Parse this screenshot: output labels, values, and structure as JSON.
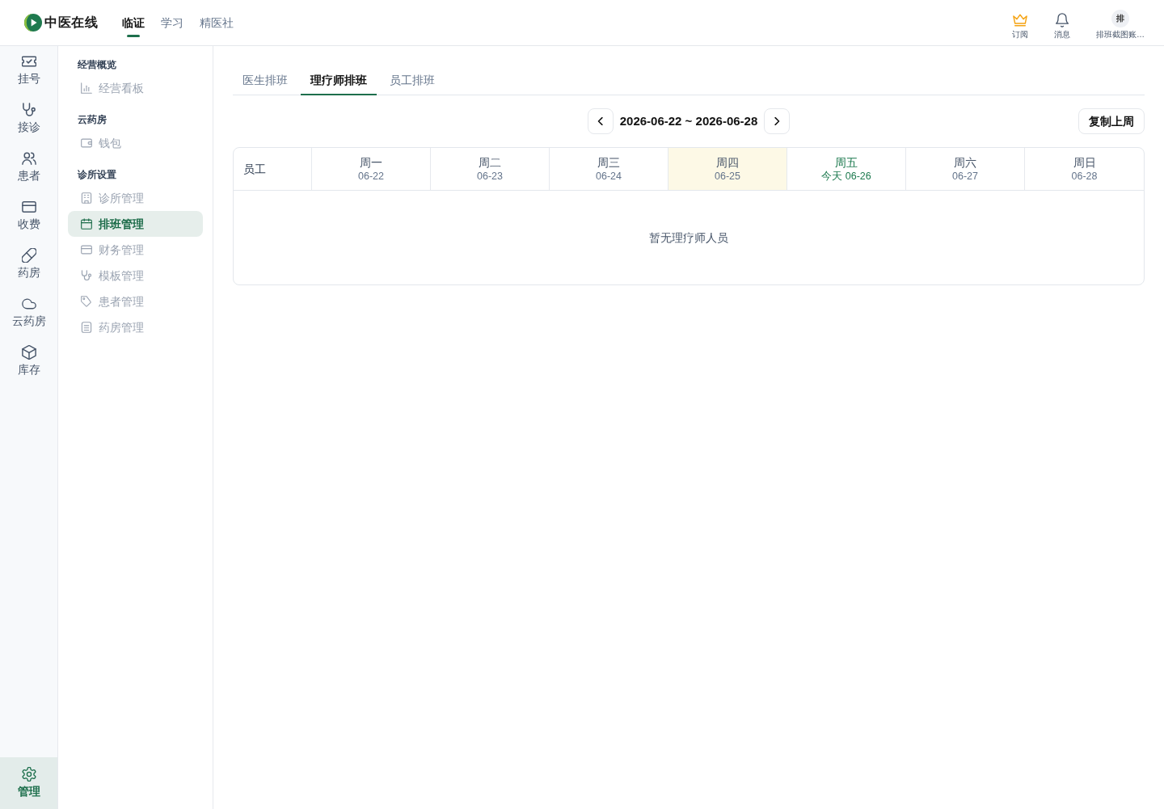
{
  "topbar": {
    "logo": "中医在线",
    "nav": [
      {
        "label": "临证",
        "selected": true
      },
      {
        "label": "学习",
        "selected": false
      },
      {
        "label": "精医社",
        "selected": false
      }
    ],
    "actions": [
      {
        "kind": "subscribe",
        "label": "订阅"
      },
      {
        "kind": "messages",
        "label": "消息"
      },
      {
        "kind": "account",
        "avatar": "排",
        "label": "排班截图账…"
      }
    ]
  },
  "rail": {
    "items": [
      {
        "label": "挂号",
        "selected": false
      },
      {
        "label": "接诊",
        "selected": false
      },
      {
        "label": "患者",
        "selected": false
      },
      {
        "label": "收费",
        "selected": false
      },
      {
        "label": "药房",
        "selected": false
      },
      {
        "label": "云药房",
        "selected": false
      },
      {
        "label": "库存",
        "selected": false
      }
    ],
    "footer": {
      "label": "管理",
      "selected": true
    }
  },
  "menu": {
    "groups": [
      {
        "title": "经营概览",
        "items": [
          {
            "label": "经营看板",
            "selected": false
          }
        ]
      },
      {
        "title": "云药房",
        "items": [
          {
            "label": "钱包",
            "selected": false
          }
        ]
      },
      {
        "title": "诊所设置",
        "items": [
          {
            "label": "诊所管理",
            "selected": false
          },
          {
            "label": "排班管理",
            "selected": true
          },
          {
            "label": "财务管理",
            "selected": false
          },
          {
            "label": "模板管理",
            "selected": false
          },
          {
            "label": "患者管理",
            "selected": false
          },
          {
            "label": "药房管理",
            "selected": false
          }
        ]
      }
    ]
  },
  "tabs": [
    {
      "label": "医生排班",
      "selected": false
    },
    {
      "label": "理疗师排班",
      "selected": true
    },
    {
      "label": "员工排班",
      "selected": false
    }
  ],
  "week_range": "2026-06-22 ~ 2026-06-28",
  "copy_button": "复制上周",
  "schedule": {
    "staff_column": "员工",
    "days": [
      {
        "weekday": "周一",
        "date": "06-22",
        "today": false,
        "highlighted": false
      },
      {
        "weekday": "周二",
        "date": "06-23",
        "today": false,
        "highlighted": false
      },
      {
        "weekday": "周三",
        "date": "06-24",
        "today": false,
        "highlighted": false
      },
      {
        "weekday": "周四",
        "date": "06-25",
        "today": false,
        "highlighted": true
      },
      {
        "weekday": "周五",
        "date": "今天 06-26",
        "today": true,
        "highlighted": false
      },
      {
        "weekday": "周六",
        "date": "06-27",
        "today": false,
        "highlighted": false
      },
      {
        "weekday": "周日",
        "date": "06-28",
        "today": false,
        "highlighted": false
      }
    ],
    "empty_message": "暂无理疗师人员"
  }
}
